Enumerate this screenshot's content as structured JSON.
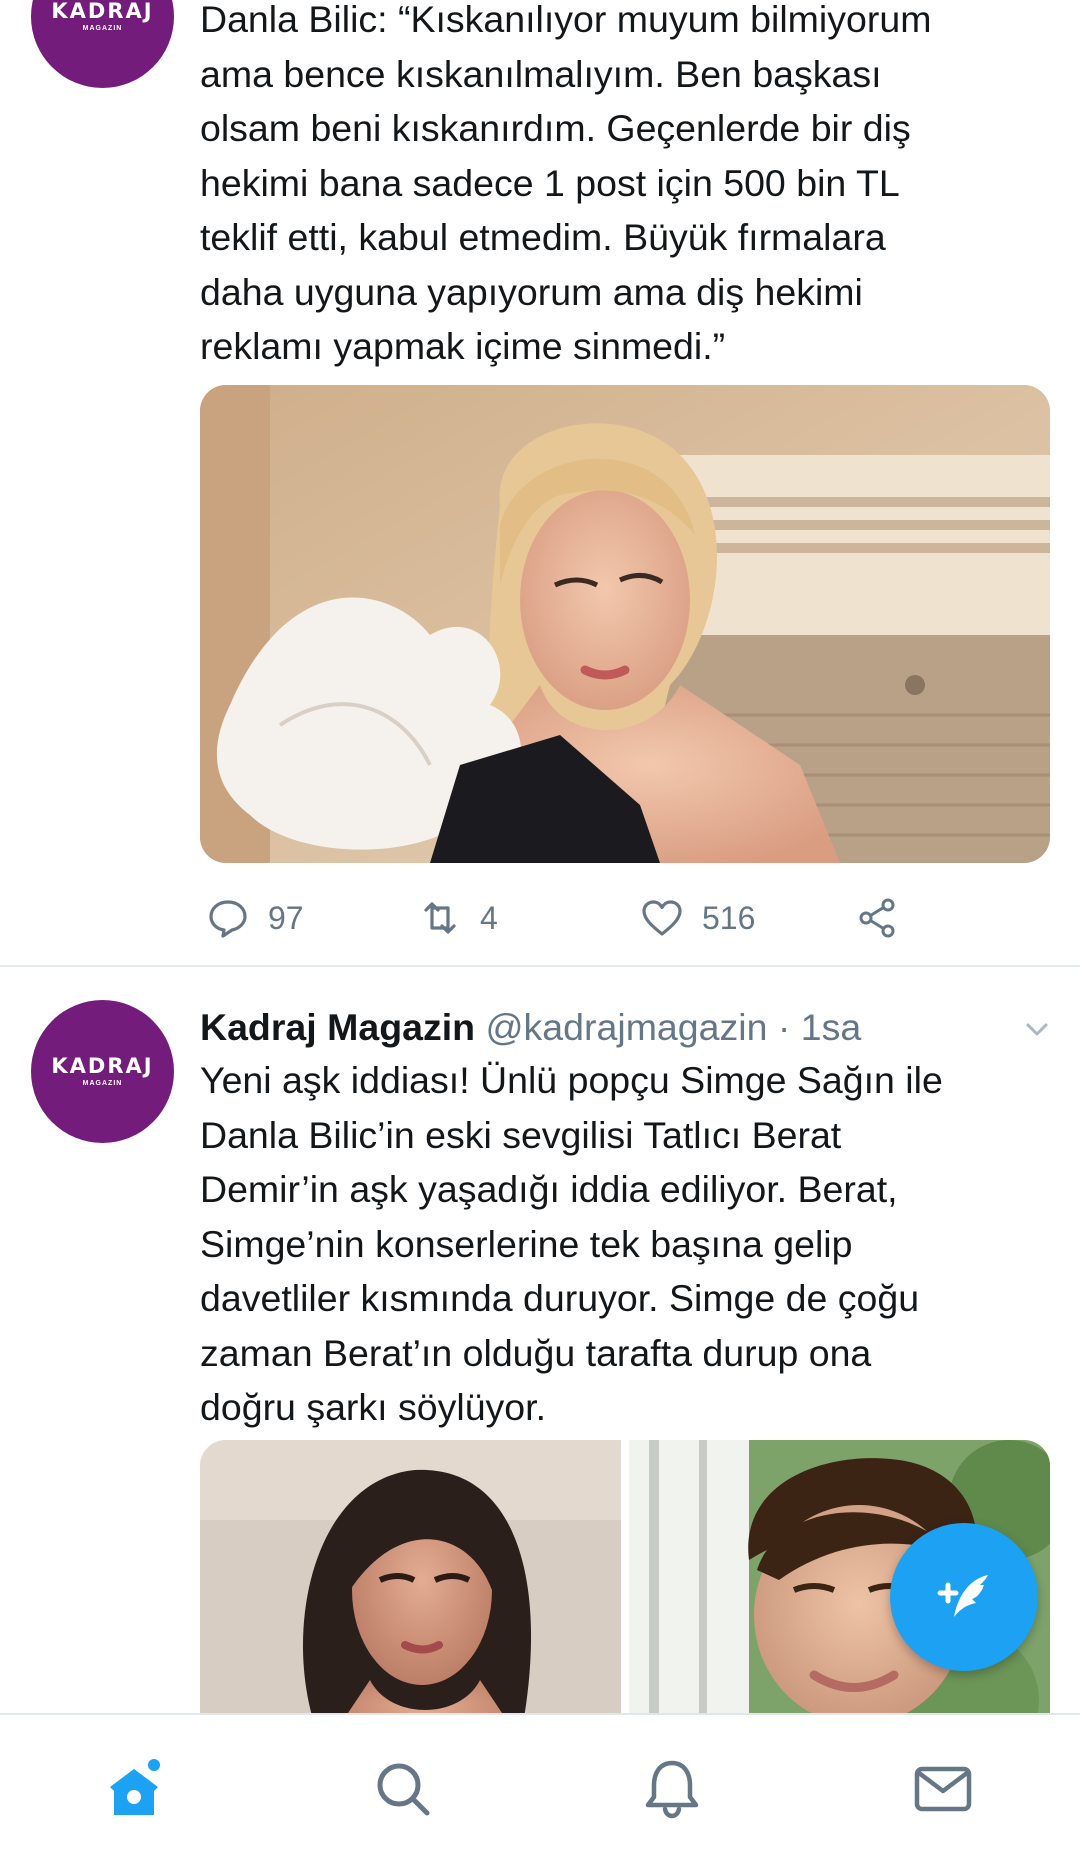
{
  "colors": {
    "accent": "#1da1f2",
    "avatar_bg": "#741c7c",
    "muted": "#657786",
    "text": "#14171a"
  },
  "tweet1": {
    "avatar": {
      "brand": "KADRAJ",
      "brand_sub": "MAGAZIN"
    },
    "text_lines": [
      "Danla Bilic: “Kıskanılıyor muyum bilmiyorum",
      "ama bence kıskanılmalıyım. Ben başkası",
      "olsam beni kıskanırdım. Geçenlerde bir diş",
      "hekimi bana sadece 1 post için 500 bin TL",
      "teklif etti, kabul etmedim. Büyük fırmalara",
      "daha uyguna yapıyorum ama diş hekimi",
      "reklamı yapmak içime sinmedi.”"
    ],
    "actions": {
      "replies": "97",
      "retweets": "4",
      "likes": "516"
    }
  },
  "tweet2": {
    "avatar": {
      "brand": "KADRAJ",
      "brand_sub": "MAGAZIN"
    },
    "name": "Kadraj Magazin",
    "handle": "@kadrajmagazin",
    "separator": "·",
    "time": "1sa",
    "text_lines": [
      "Yeni aşk iddiası! Ünlü popçu Simge Sağın ile",
      "Danla Bilic’in eski sevgilisi Tatlıcı Berat",
      "Demir’in aşk yaşadığı iddia ediliyor. Berat,",
      "Simge’nin konserlerine tek başına gelip",
      "davetliler kısmında duruyor. Simge de çoğu",
      "zaman Berat’ın olduğu tarafta durup ona",
      "doğru şarkı söylüyor."
    ]
  },
  "icons": {
    "reply": "reply-icon",
    "retweet": "retweet-icon",
    "like": "heart-icon",
    "share": "share-icon",
    "compose": "compose-tweet-icon",
    "home": "home-icon",
    "search": "search-icon",
    "notifications": "bell-icon",
    "messages": "mail-icon",
    "more": "chevron-down-icon"
  }
}
